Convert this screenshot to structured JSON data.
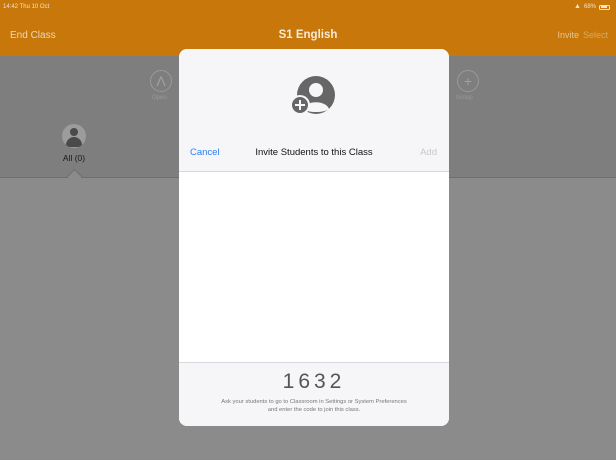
{
  "status_bar": {
    "time": "14:42",
    "date": "Thu 10 Oct",
    "battery": "68%"
  },
  "nav": {
    "left": "End Class",
    "title": "S1 English",
    "invite": "Invite",
    "select": "Select"
  },
  "toolbar": {
    "open_label": "Open",
    "group_label": "Group"
  },
  "group_filter": {
    "label": "All (0)"
  },
  "modal": {
    "cancel": "Cancel",
    "title": "Invite Students to this Class",
    "add": "Add",
    "code": "1632",
    "hint_line1": "Ask your students to go to Classroom in Settings or System Preferences",
    "hint_line2": "and enter the code to join this class."
  },
  "colors": {
    "accent": "#c8780a",
    "link": "#2e7ef7",
    "disabled": "#c7c7cc"
  }
}
